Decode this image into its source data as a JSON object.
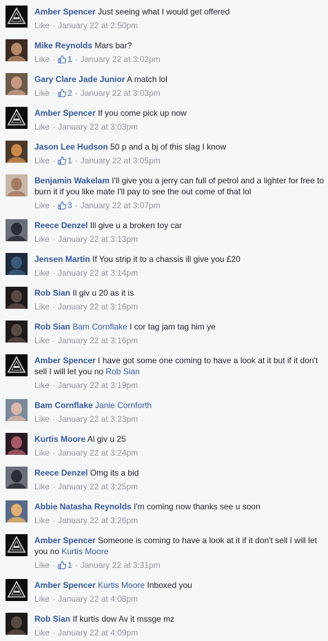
{
  "like_label": "Like",
  "separator": "·",
  "comments": [
    {
      "author": "Amber Spencer",
      "segments": [
        {
          "t": "Just seeing what I would get offered"
        }
      ],
      "time": "January 22 at 2:50pm",
      "likes": "",
      "avatar": "logo"
    },
    {
      "author": "Mike Reynolds",
      "segments": [
        {
          "t": "Mars bar?"
        }
      ],
      "time": "January 22 at 3:02pm",
      "likes": "1",
      "avatar": "photo",
      "c1": "#b58a6a",
      "c2": "#3b2a22"
    },
    {
      "author": "Gary Clare Jade Junior",
      "segments": [
        {
          "t": "A match lol"
        }
      ],
      "time": "January 22 at 3:03pm",
      "likes": "2",
      "avatar": "photo",
      "c1": "#c79a86",
      "c2": "#6b5a4a"
    },
    {
      "author": "Amber Spencer",
      "segments": [
        {
          "t": "If you come pick up now"
        }
      ],
      "time": "January 22 at 3:03pm",
      "likes": "",
      "avatar": "logo"
    },
    {
      "author": "Jason Lee Hudson",
      "segments": [
        {
          "t": "50 p and a bj of this slag I know"
        }
      ],
      "time": "January 22 at 3:05pm",
      "likes": "1",
      "avatar": "photo",
      "c1": "#c9884c",
      "c2": "#4a3a2a"
    },
    {
      "author": "Benjamin Wakelam",
      "segments": [
        {
          "t": "I'll give you a jerry can full of petrol and a lighter for free to burn it if you like mate I'll pay to see the out come of that lol"
        }
      ],
      "time": "January 22 at 3:07pm",
      "likes": "3",
      "avatar": "photo",
      "c1": "#a57c63",
      "c2": "#c7b7a8"
    },
    {
      "author": "Reece Denzel",
      "segments": [
        {
          "t": "Ill give u a broken toy car"
        }
      ],
      "time": "January 22 at 3:13pm",
      "likes": "",
      "avatar": "photo",
      "c1": "#2a2d36",
      "c2": "#6a6f7a"
    },
    {
      "author": "Jensen Martin",
      "segments": [
        {
          "t": "If You strip it to a chassis ill give you £20"
        }
      ],
      "time": "January 22 at 3:14pm",
      "likes": "",
      "avatar": "photo",
      "c1": "#3a5a7a",
      "c2": "#1f2a3a"
    },
    {
      "author": "Rob Sian",
      "segments": [
        {
          "t": "Il giv u 20 as it is"
        }
      ],
      "time": "January 22 at 3:16pm",
      "likes": "",
      "avatar": "photo",
      "c1": "#5a4a44",
      "c2": "#1e1a1a"
    },
    {
      "author": "Rob Sian",
      "segments": [
        {
          "t": "Bam Cornflake",
          "tag": true
        },
        {
          "t": " I cor tag jam tag him ye"
        }
      ],
      "time": "January 22 at 3:16pm",
      "likes": "",
      "avatar": "photo",
      "c1": "#5a4a44",
      "c2": "#1e1a1a"
    },
    {
      "author": "Amber Spencer",
      "segments": [
        {
          "t": "I have got some one coming to have a look at it but if it don't sell I will let you no "
        },
        {
          "t": "Rob Sian",
          "tag": true
        }
      ],
      "time": "January 22 at 3:19pm",
      "likes": "",
      "avatar": "logo"
    },
    {
      "author": "Bam Cornflake",
      "segments": [
        {
          "t": "Janie Cornforth",
          "tag": true
        }
      ],
      "time": "January 22 at 3:23pm",
      "likes": "",
      "avatar": "photo",
      "c1": "#d9b6a8",
      "c2": "#7a8a9a"
    },
    {
      "author": "Kurtis Moore",
      "segments": [
        {
          "t": "Al giv u 25"
        }
      ],
      "time": "January 22 at 3:24pm",
      "likes": "",
      "avatar": "photo",
      "c1": "#a45a6a",
      "c2": "#2a1a24"
    },
    {
      "author": "Reece Denzel",
      "segments": [
        {
          "t": "Omg its a bid"
        }
      ],
      "time": "January 22 at 3:25pm",
      "likes": "",
      "avatar": "photo",
      "c1": "#2a2d36",
      "c2": "#6a6f7a"
    },
    {
      "author": "Abbie Natasha Reynolds",
      "segments": [
        {
          "t": "I'm coming now thanks see u soon"
        }
      ],
      "time": "January 22 at 3:26pm",
      "likes": "",
      "avatar": "photo",
      "c1": "#e0b070",
      "c2": "#5a6a8a"
    },
    {
      "author": "Amber Spencer",
      "segments": [
        {
          "t": "Someone is coming to have a look at it if it don't sell I will let you no "
        },
        {
          "t": "Kurtis Moore",
          "tag": true
        }
      ],
      "time": "January 22 at 3:31pm",
      "likes": "1",
      "avatar": "logo"
    },
    {
      "author": "Amber Spencer",
      "segments": [
        {
          "t": "Kurtis Moore",
          "tag": true
        },
        {
          "t": " Inboxed you"
        }
      ],
      "time": "January 22 at 4:08pm",
      "likes": "",
      "avatar": "logo"
    },
    {
      "author": "Rob Sian",
      "segments": [
        {
          "t": "If kurtis dow Av it mssge mz"
        }
      ],
      "time": "January 22 at 4:09pm",
      "likes": "",
      "avatar": "photo",
      "c1": "#5a4a44",
      "c2": "#1e1a1a"
    }
  ]
}
